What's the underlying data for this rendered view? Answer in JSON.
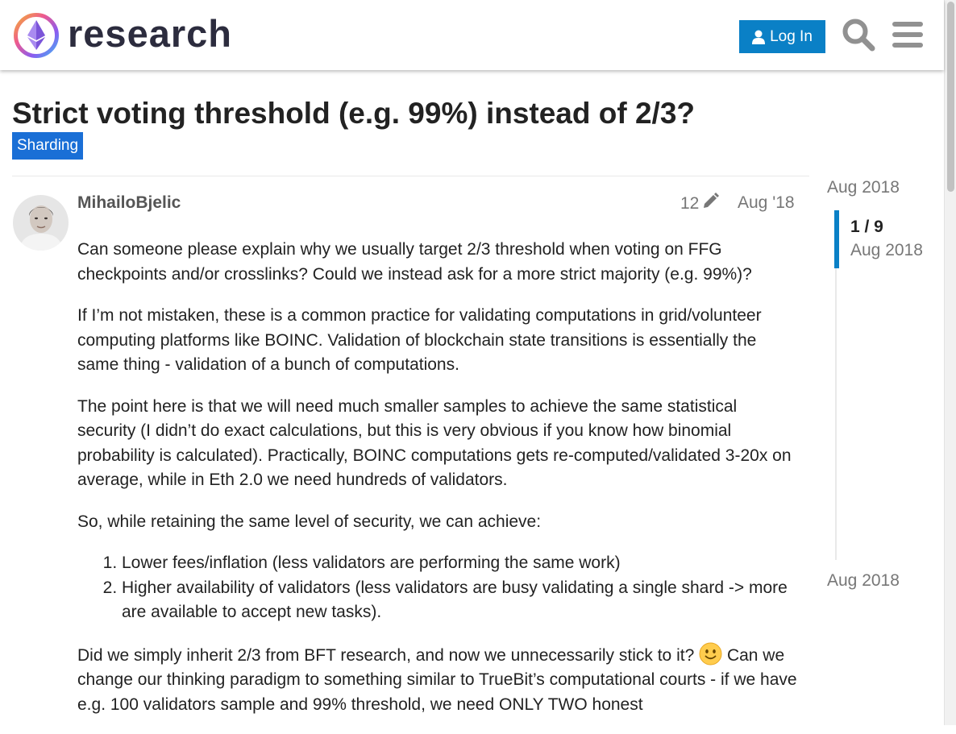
{
  "header": {
    "site_name": "research",
    "login_label": "Log In",
    "icons": {
      "logo": "ethereum-research-logo",
      "user": "user-icon",
      "search": "search-icon",
      "menu": "hamburger-menu-icon"
    },
    "colors": {
      "login_button": "#0a80c6",
      "icon_gray": "#919191"
    }
  },
  "topic": {
    "title": "Strict voting threshold (e.g. 99%) instead of 2/3?",
    "category": "Sharding",
    "category_color": "#1a6fd6"
  },
  "post": {
    "username": "MihailoBjelic",
    "edit_count": "12",
    "date": "Aug '18",
    "paragraphs": [
      "Can someone please explain why we usually target 2/3 threshold when voting on FFG checkpoints and/or crosslinks? Could we instead ask for a more strict majority (e.g. 99%)?",
      "If I’m not mistaken, these is a common practice for validating computations in grid/volunteer computing platforms like BOINC. Validation of blockchain state transitions is essentially the same thing - validation of a bunch of computations.",
      "The point here is that we will need much smaller samples to achieve the same statistical security (I didn’t do exact calculations, but this is very obvious if you know how binomial probability is calculated). Practically, BOINC computations gets re-computed/validated 3-20x on average, while in Eth 2.0 we need hundreds of validators.",
      "So, while retaining the same level of security, we can achieve:"
    ],
    "list": [
      "Lower fees/inflation (less validators are performing the same work)",
      "Higher availability of validators (less validators are busy validating a single shard -> more are available to accept new tasks)."
    ],
    "last_paragraph_before": "Did we simply inherit 2/3 from BFT research, and now we unnecessarily stick to it?",
    "last_paragraph_after": "Can we change our thinking paradigm to something similar to TrueBit’s computational courts - if we have e.g. 100 validators sample and 99% threshold, we need ONLY TWO honest",
    "emoji": "slightly-smiling-face-icon"
  },
  "timeline": {
    "start_date": "Aug 2018",
    "position": "1 / 9",
    "current_date": "Aug 2018",
    "end_date": "Aug 2018",
    "accent": "#0a80c6"
  }
}
